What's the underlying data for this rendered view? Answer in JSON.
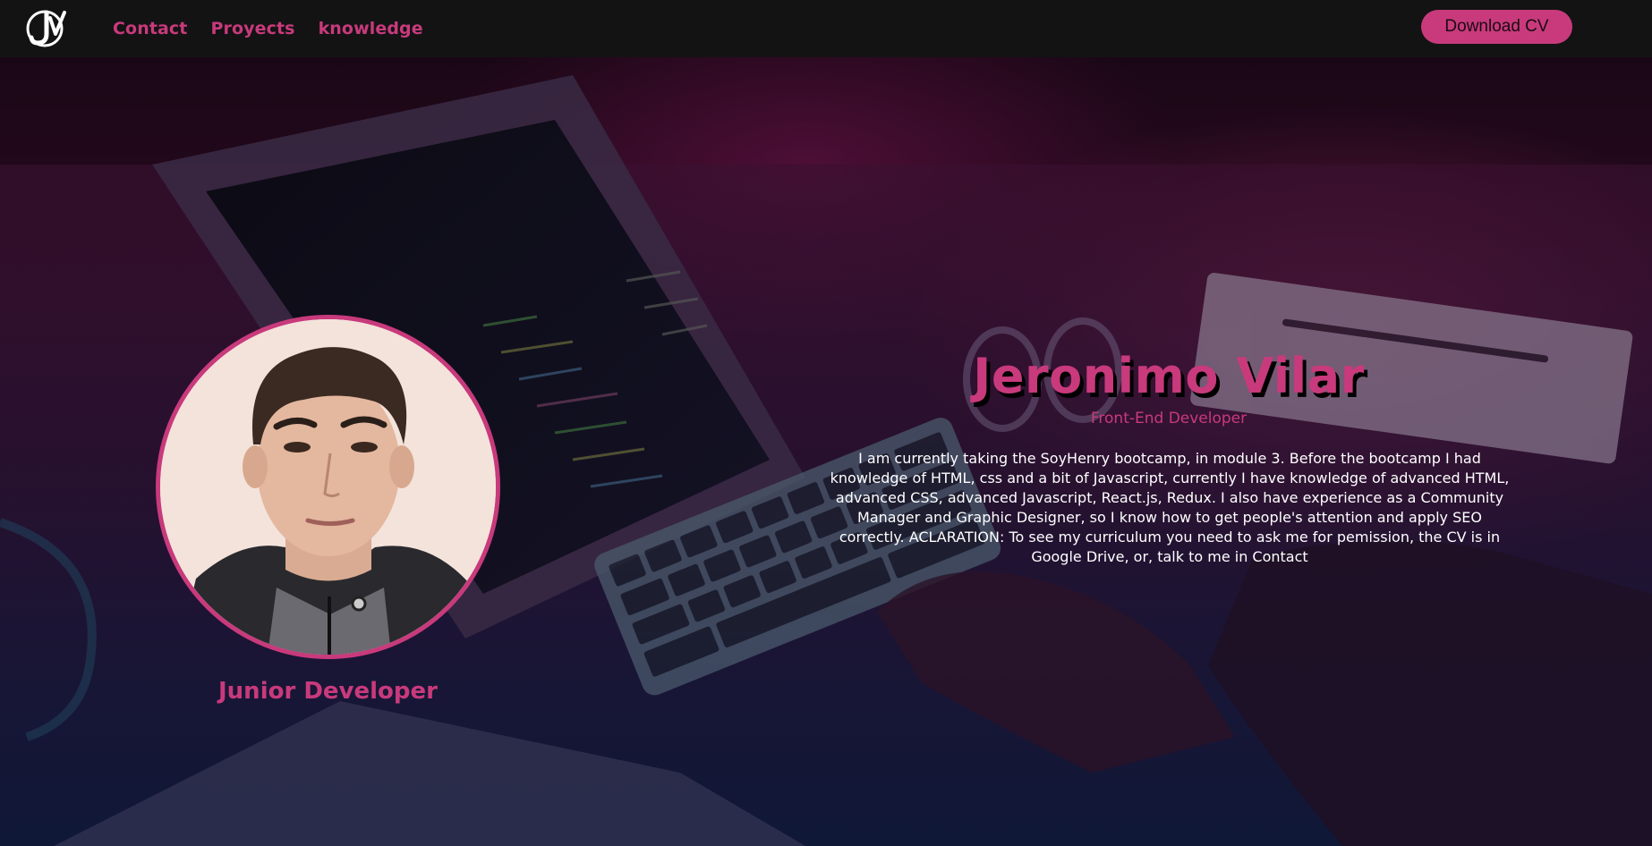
{
  "nav": {
    "logo_text": "JV",
    "links": [
      "Contact",
      "Proyects",
      "knowledge"
    ],
    "cv_button": "Download CV"
  },
  "profile": {
    "role": "Junior Developer",
    "name": "Jeronimo Vilar",
    "subtitle": "Front-End Developer",
    "bio": "I am currently taking the SoyHenry bootcamp, in module 3. Before the bootcamp I had knowledge of HTML, css and a bit of Javascript, currently I have knowledge of advanced HTML, advanced CSS, advanced Javascript, React.js, Redux. I also have experience as a Community Manager and Graphic Designer, so I know how to get people's attention and apply SEO correctly. ACLARATION: To see my curriculum you need to ask me for pemission, the CV is in Google Drive, or, talk to me in Contact"
  },
  "colors": {
    "accent": "#c83a7c",
    "navbar": "#131313",
    "text_light": "#ffffff"
  },
  "icons": {
    "logo": "jv-logo-icon"
  }
}
